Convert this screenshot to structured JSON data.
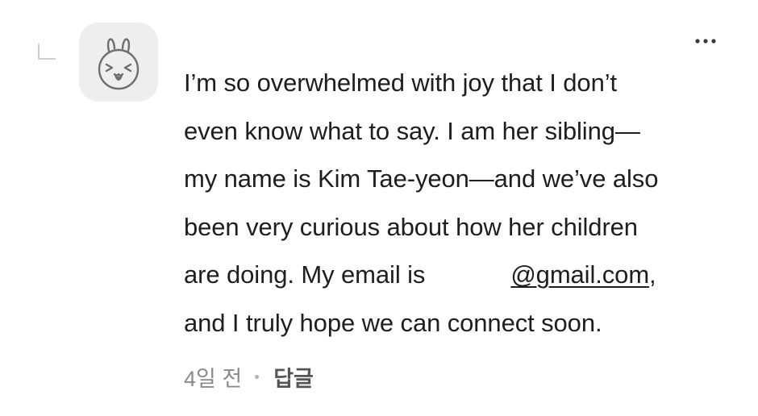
{
  "comment": {
    "lines": {
      "l1": "I’m so overwhelmed with joy that I don’t",
      "l2": "even know what to say. I am her sibling—",
      "l3": "my name is Kim Tae-yeon—and we’ve also",
      "l4": "been very curious about how her children",
      "l5_prefix": "are doing. My email is",
      "l5_link": "@gmail.com",
      "l5_suffix": ",",
      "l6": "and I truly hope we can connect soon."
    },
    "timestamp": "4일 전",
    "reply_label": "답글"
  },
  "icons": {
    "avatar": "bunny-avatar-icon",
    "more": "more-options-icon",
    "reply_indicator": "reply-thread-icon"
  },
  "colors": {
    "text": "#1e1e1e",
    "meta": "#8a8a8a",
    "avatar_bg": "#eeeeee"
  }
}
